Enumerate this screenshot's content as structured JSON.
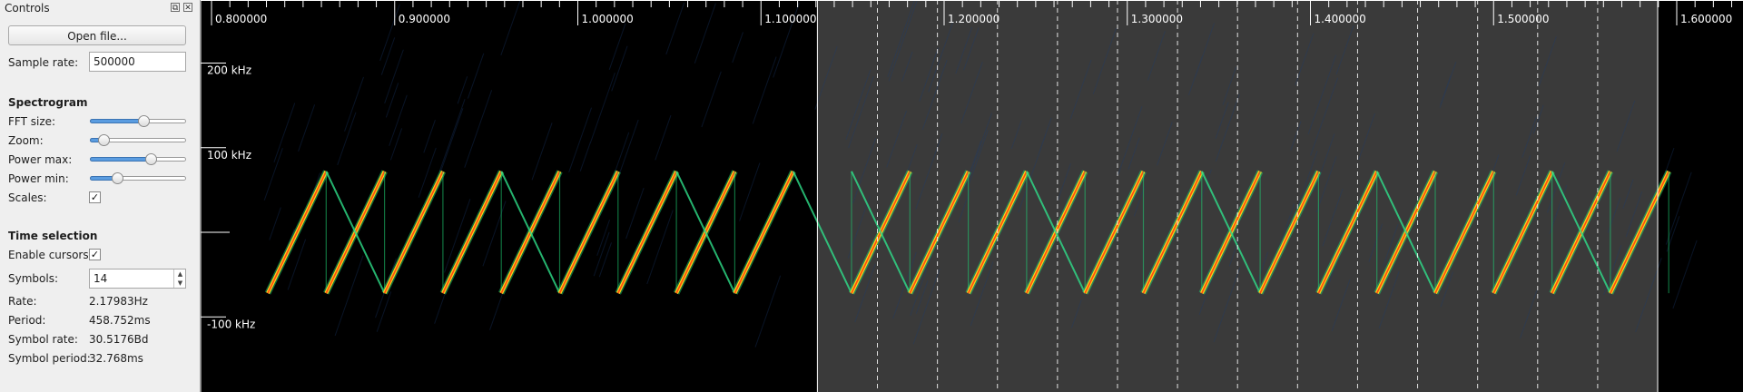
{
  "panel": {
    "title": "Controls",
    "float_icon": "⧉",
    "close_icon": "✕",
    "open_file_label": "Open file...",
    "sample_rate_label": "Sample rate:",
    "sample_rate_value": "500000",
    "spectrogram_heading": "Spectrogram",
    "fft_size_label": "FFT size:",
    "fft_size_level": 0.56,
    "zoom_label": "Zoom:",
    "zoom_level": 0.14,
    "power_max_label": "Power max:",
    "power_max_level": 0.63,
    "power_min_label": "Power min:",
    "power_min_level": 0.28,
    "scales_label": "Scales:",
    "scales_checked": true,
    "time_selection_heading": "Time selection",
    "enable_cursors_label": "Enable cursors:",
    "enable_cursors_checked": true,
    "symbols_label": "Symbols:",
    "symbols_value": "14",
    "rate_label": "Rate:",
    "rate_value": "2.17983Hz",
    "period_label": "Period:",
    "period_value": "458.752ms",
    "symbol_rate_label": "Symbol rate:",
    "symbol_rate_value": "30.5176Bd",
    "symbol_period_label": "Symbol period:",
    "symbol_period_value": "32.768ms",
    "check_glyph": "✓"
  },
  "spectrogram": {
    "time_ticks": [
      "0.800000",
      "0.900000",
      "1.000000",
      "1.100000",
      "1.200000",
      "1.300000",
      "1.400000",
      "1.500000",
      "1.600000"
    ],
    "time_tick_values": [
      0.8,
      0.9,
      1.0,
      1.1,
      1.2,
      1.3,
      1.4,
      1.5,
      1.6
    ],
    "time_view_range": [
      0.79375,
      1.655
    ],
    "freq_ticks": [
      {
        "label": "200 kHz",
        "value": 200
      },
      {
        "label": "100 kHz",
        "value": 100
      },
      {
        "label": "-100 kHz",
        "value": -100
      }
    ],
    "freq_range": [
      -170,
      250
    ],
    "selection": {
      "start": 1.1308,
      "end": 1.5896,
      "symbols": 14
    },
    "colors": {
      "background": "#000000",
      "selection_fill": "#3a3a3a",
      "cursor_line": "#ffffff",
      "chirp_core": "#ff4a10",
      "chirp_mid": "#ffd21a",
      "chirp_glow": "#1fcf73",
      "downchirp": "#2fe08a"
    }
  }
}
